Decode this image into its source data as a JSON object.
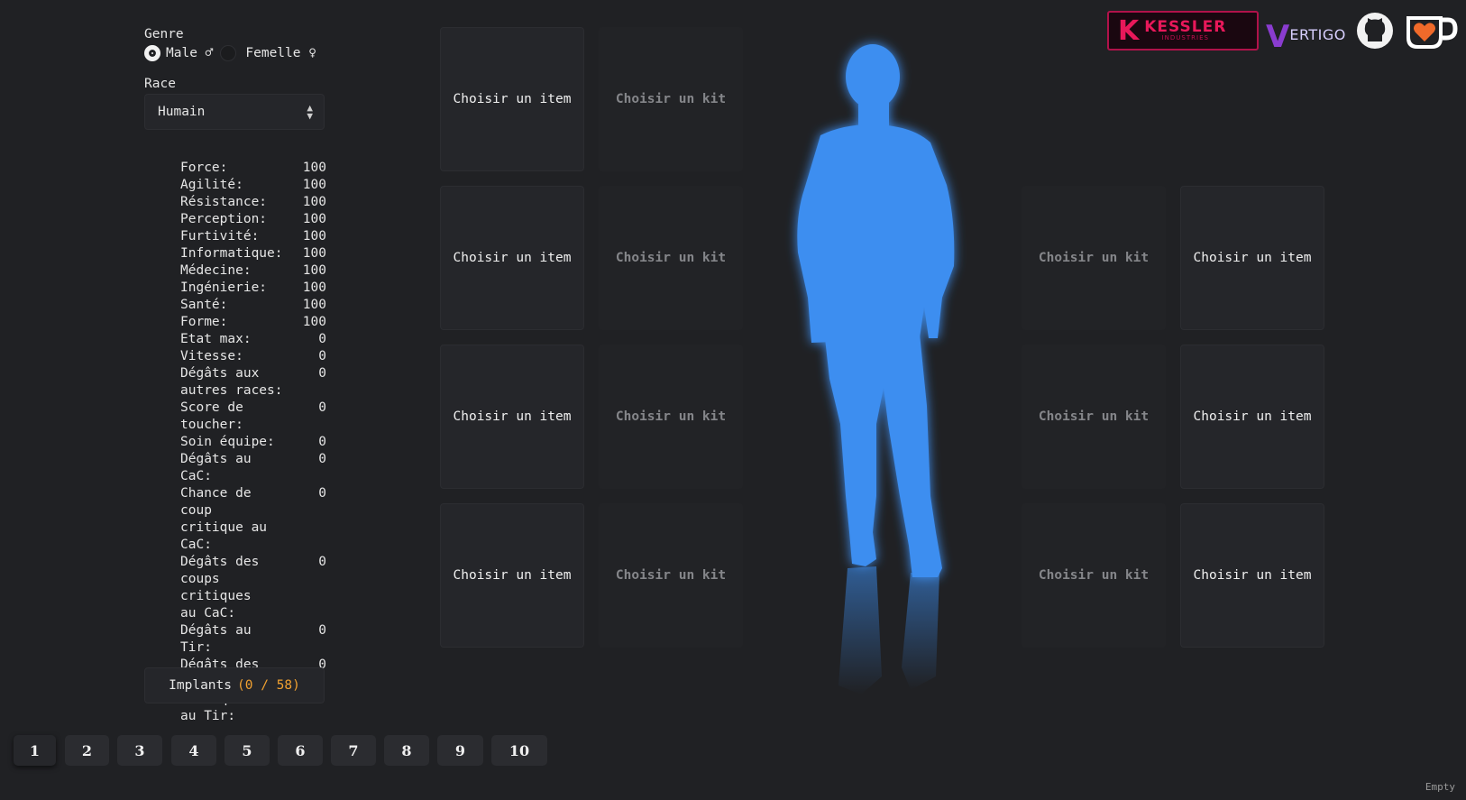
{
  "left_panel": {
    "genre_label": "Genre",
    "gender_options": [
      {
        "label": "Male ♂",
        "selected": true
      },
      {
        "label": "Femelle ♀",
        "selected": false
      }
    ],
    "race_label": "Race",
    "race_value": "Humain",
    "stats": [
      {
        "name": "Force:",
        "value": "100"
      },
      {
        "name": "Agilité:",
        "value": "100"
      },
      {
        "name": "Résistance:",
        "value": "100"
      },
      {
        "name": "Perception:",
        "value": "100"
      },
      {
        "name": "Furtivité:",
        "value": "100"
      },
      {
        "name": "Informatique:",
        "value": "100"
      },
      {
        "name": "Médecine:",
        "value": "100"
      },
      {
        "name": "Ingénierie:",
        "value": "100"
      },
      {
        "name": "Santé:",
        "value": "100"
      },
      {
        "name": "Forme:",
        "value": "100"
      },
      {
        "name": "Etat max:",
        "value": "0"
      },
      {
        "name": "Vitesse:",
        "value": "0"
      },
      {
        "name": "Dégâts aux\nautres races:",
        "value": "0"
      },
      {
        "name": "Score de\ntoucher:",
        "value": "0"
      },
      {
        "name": "Soin équipe:",
        "value": "0"
      },
      {
        "name": "Dégâts au CaC:",
        "value": "0"
      },
      {
        "name": "Chance de coup\ncritique au\nCaC:",
        "value": "0"
      },
      {
        "name": "Dégâts des\ncoups critiques\nau CaC:",
        "value": "0"
      },
      {
        "name": "Dégâts au Tir:",
        "value": "0"
      },
      {
        "name": "Dégâts des\ncoups critiques\nau Tir:",
        "value": "0"
      }
    ],
    "implants_label": "Implants",
    "implants_count": "(0 / 58)"
  },
  "slots": {
    "item_label": "Choisir un item",
    "kit_label": "Choisir un kit"
  },
  "pagination": [
    "1",
    "2",
    "3",
    "4",
    "5",
    "6",
    "7",
    "8",
    "9",
    "10"
  ],
  "active_page": "1",
  "footer_status": "Empty",
  "logos": {
    "kessler_text": "KESSLER",
    "kessler_sub": "INDUSTRIES",
    "vertigo_text": "ERTIGO"
  },
  "colors": {
    "background": "#202124",
    "silhouette": "#3d8ef0",
    "implant_count": "#f0a030",
    "kessler": "#e8185a",
    "vertigo": "#8a3cd0"
  }
}
